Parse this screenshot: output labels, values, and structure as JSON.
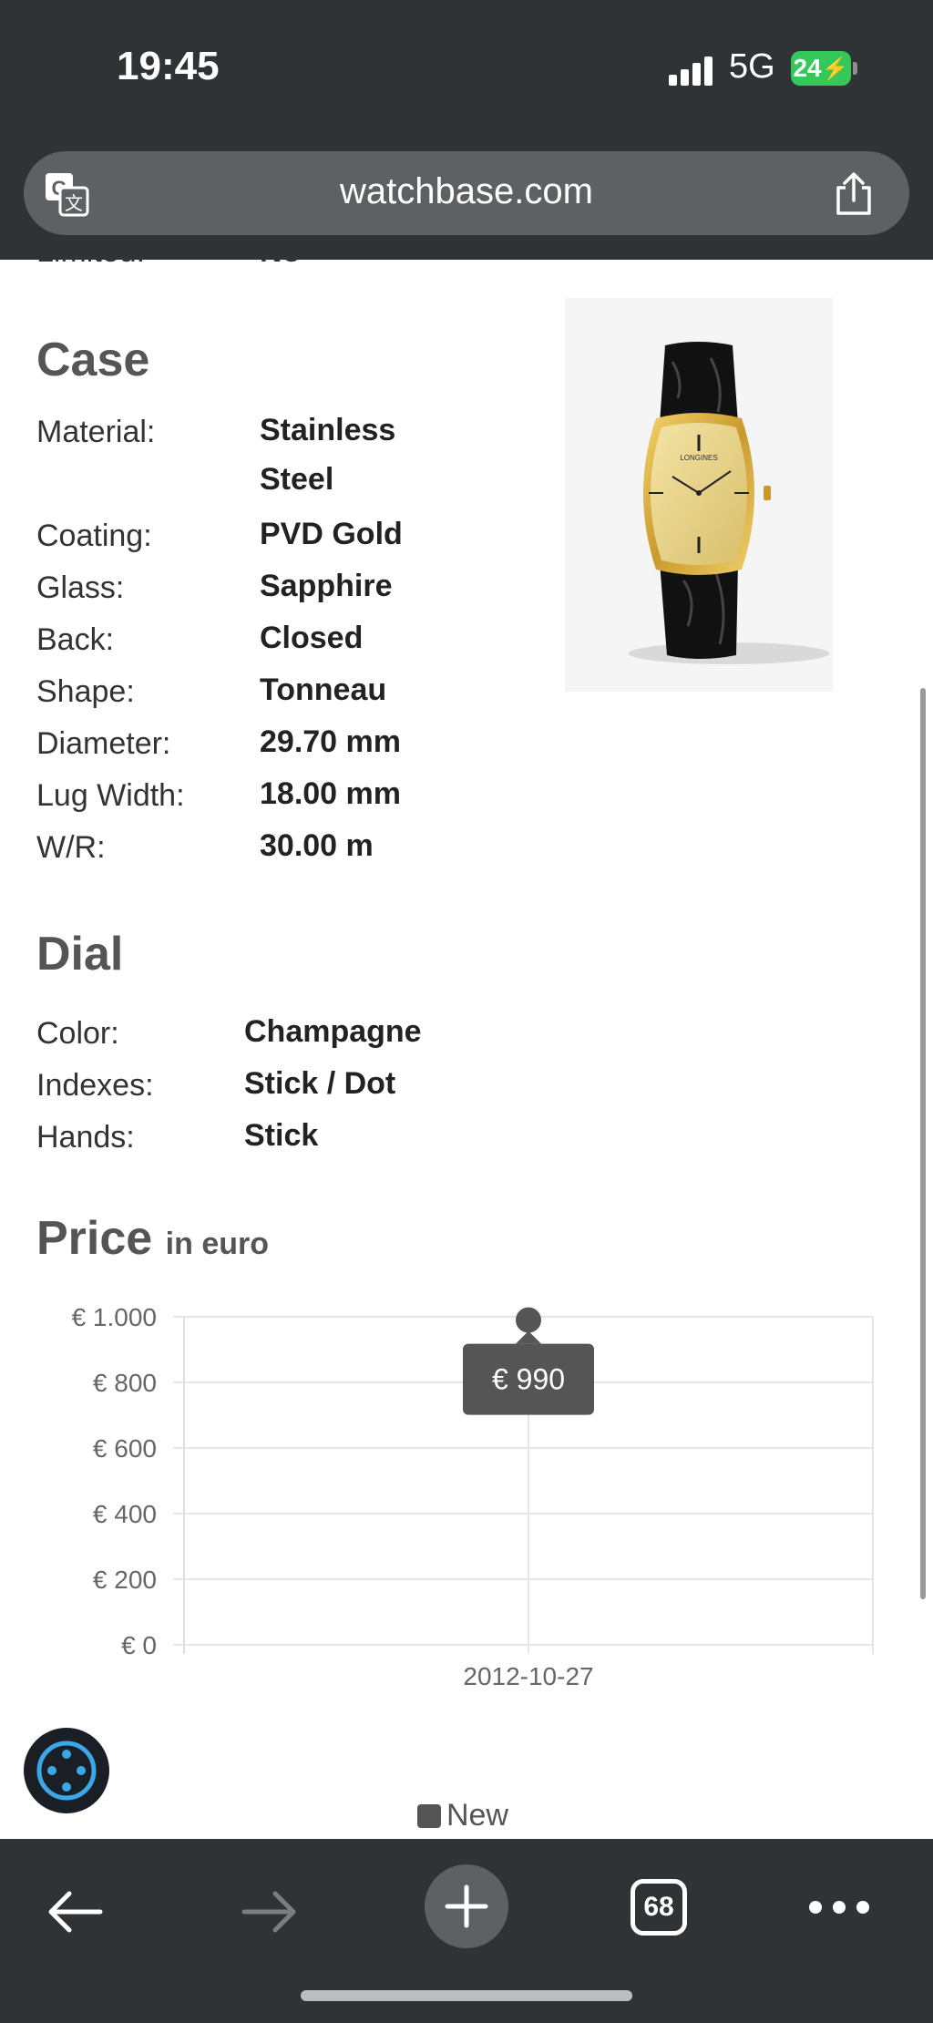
{
  "status": {
    "time": "19:45",
    "network": "5G",
    "battery": "24"
  },
  "browser": {
    "url": "watchbase.com",
    "tabs_count": "68"
  },
  "cutoff_row": {
    "label": "Limited:",
    "value": "No"
  },
  "case": {
    "title": "Case",
    "rows": [
      {
        "label": "Material:",
        "value": "Stainless",
        "value2": "Steel"
      },
      {
        "label": "Coating:",
        "value": "PVD Gold"
      },
      {
        "label": "Glass:",
        "value": "Sapphire"
      },
      {
        "label": "Back:",
        "value": "Closed"
      },
      {
        "label": "Shape:",
        "value": "Tonneau"
      },
      {
        "label": "Diameter:",
        "value": "29.70 mm"
      },
      {
        "label": "Lug Width:",
        "value": "18.00 mm"
      },
      {
        "label": "W/R:",
        "value": "30.00 m"
      }
    ]
  },
  "dial": {
    "title": "Dial",
    "rows": [
      {
        "label": "Color:",
        "value": "Champagne"
      },
      {
        "label": "Indexes:",
        "value": "Stick / Dot"
      },
      {
        "label": "Hands:",
        "value": "Stick"
      }
    ]
  },
  "price": {
    "title": "Price",
    "subtitle": "in euro"
  },
  "chart_data": {
    "type": "line",
    "x": [
      "2012-10-27"
    ],
    "series": [
      {
        "name": "New",
        "values": [
          990
        ]
      }
    ],
    "ylim": [
      0,
      1000
    ],
    "yticks": [
      "€ 0",
      "€ 200",
      "€ 400",
      "€ 600",
      "€ 800",
      "€ 1.000"
    ],
    "tooltip": "€ 990",
    "grid": true,
    "legend": "bottom"
  }
}
